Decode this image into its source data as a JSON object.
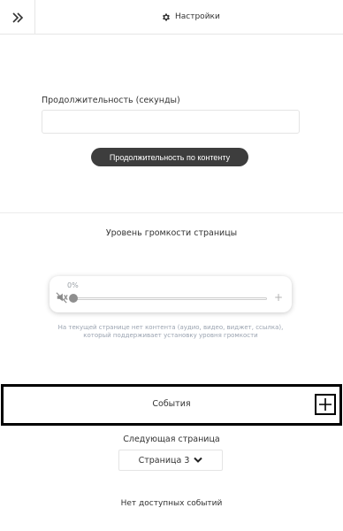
{
  "header": {
    "collapse_icon": "double-chevron-right-icon",
    "settings_icon": "gear-icon",
    "title": "Настройки"
  },
  "duration": {
    "label": "Продолжительность (секунды)",
    "value": "",
    "placeholder": "",
    "content_button_label": "Продолжительность по контенту"
  },
  "volume": {
    "title": "Уровень громкости страницы",
    "percent_label": "0%",
    "level": 0,
    "mute_icon": "volume-mute-icon",
    "plus_label": "+",
    "note": "На текущей странице нет контента (аудио, видео, виджет, ссылка), который поддерживает установку уровня громкости"
  },
  "events": {
    "title": "События",
    "add_icon": "plus-icon"
  },
  "next_page": {
    "label": "Следующая страница",
    "selected": "Страница 3",
    "dropdown_icon": "chevron-down-icon"
  },
  "empty_events_text": "Нет доступных событий"
}
